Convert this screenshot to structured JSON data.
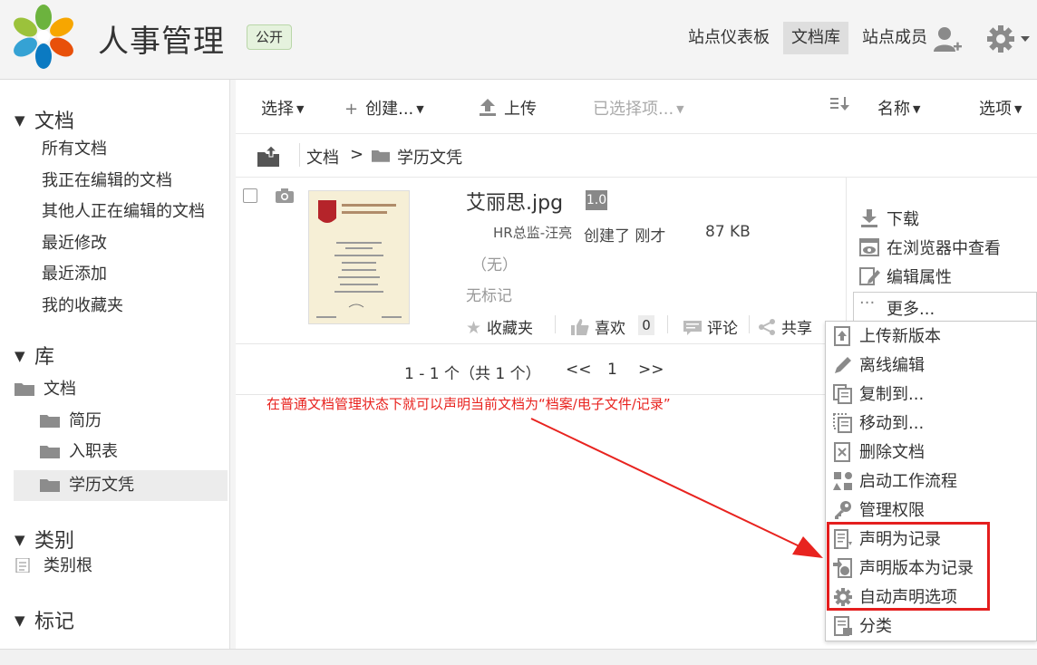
{
  "header": {
    "site_title": "人事管理",
    "visibility": "公开",
    "nav": [
      {
        "label": "站点仪表板",
        "active": false
      },
      {
        "label": "文档库",
        "active": true
      },
      {
        "label": "站点成员",
        "active": false
      }
    ],
    "user_icon": "add-user-icon",
    "settings_icon": "gear-icon"
  },
  "sidebar": {
    "documents_heading": "文档",
    "document_links": [
      "所有文档",
      "我正在编辑的文档",
      "其他人正在编辑的文档",
      "最近修改",
      "最近添加",
      "我的收藏夹"
    ],
    "library_heading": "库",
    "library_root": "文档",
    "folders": [
      "简历",
      "入职表",
      "学历文凭"
    ],
    "selected_folder": "学历文凭",
    "categories_heading": "类别",
    "category_root": "类别根",
    "tags_heading": "标记"
  },
  "toolbar": {
    "select": "选择",
    "create": "创建...",
    "upload": "上传",
    "selected_items": "已选择项...",
    "sort_field": "名称",
    "options": "选项"
  },
  "breadcrumb": {
    "root": "文档",
    "separator": ">",
    "current": "学历文凭"
  },
  "document": {
    "name": "艾丽思.jpg",
    "version": "1.0",
    "creator": "HR总监-汪亮",
    "created_text": "创建了 刚才",
    "size": "87 KB",
    "description": "（无）",
    "tags": "无标记",
    "favorite": "收藏夹",
    "like": "喜欢",
    "like_count": "0",
    "comment": "评论",
    "share": "共享"
  },
  "document_actions": {
    "download": "下载",
    "view_in_browser": "在浏览器中查看",
    "edit_properties": "编辑属性",
    "more": "更多..."
  },
  "more_menu": [
    {
      "label": "上传新版本",
      "icon": "upload-version-icon"
    },
    {
      "label": "离线编辑",
      "icon": "pencil-icon"
    },
    {
      "label": "复制到...",
      "icon": "copy-icon"
    },
    {
      "label": "移动到...",
      "icon": "move-icon"
    },
    {
      "label": "删除文档",
      "icon": "delete-icon"
    },
    {
      "label": "启动工作流程",
      "icon": "workflow-icon"
    },
    {
      "label": "管理权限",
      "icon": "key-icon"
    },
    {
      "label": "声明为记录",
      "icon": "declare-record-icon"
    },
    {
      "label": "声明版本为记录",
      "icon": "declare-version-icon"
    },
    {
      "label": "自动声明选项",
      "icon": "auto-declare-icon"
    },
    {
      "label": "分类",
      "icon": "classify-icon"
    }
  ],
  "pagination": {
    "summary": "1 - 1 个（共 1 个）",
    "prev": "<<",
    "page": "1",
    "next": ">>"
  },
  "annotation": "在普通文档管理状态下就可以声明当前文档为“档案/电子文件/记录”",
  "colors": {
    "annotation_red": "#e8231f",
    "badge_green": "#e5f2dd",
    "selected_gray": "#ececec"
  }
}
